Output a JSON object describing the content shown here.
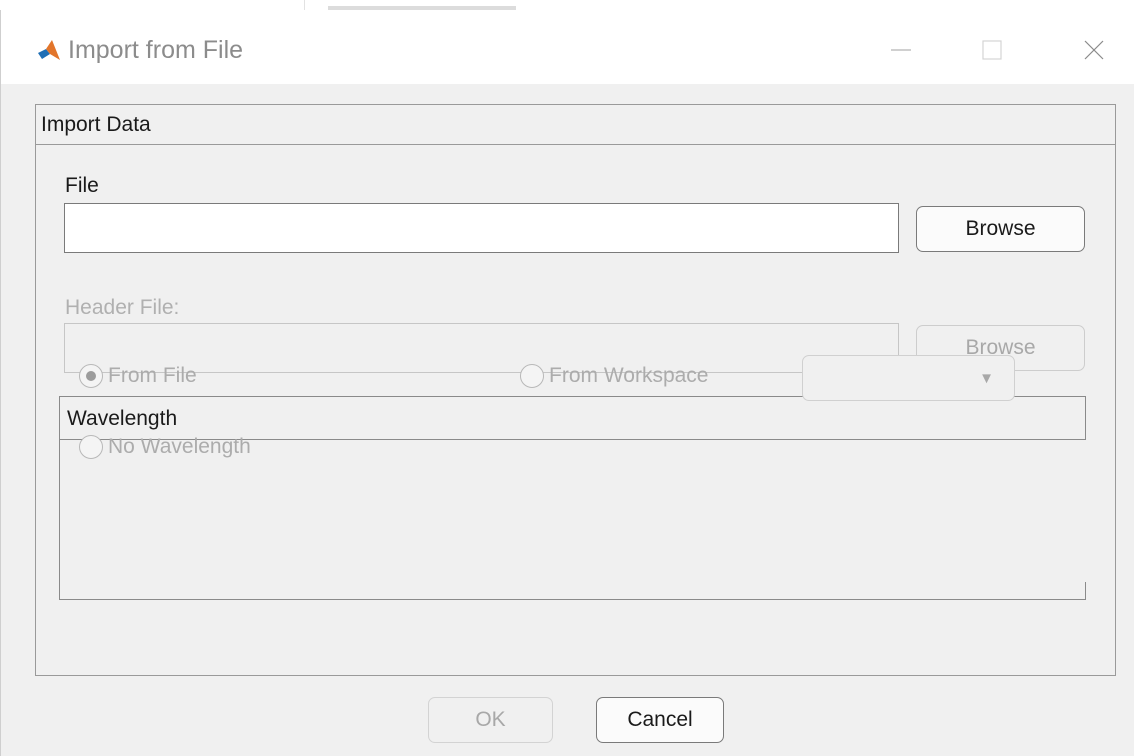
{
  "window": {
    "title": "Import from File",
    "app_icon": "matlab-icon",
    "controls": [
      "minimize-icon",
      "maximize-icon",
      "close-icon"
    ]
  },
  "panel": {
    "title": "Import Data",
    "file_label": "File",
    "file_value": "",
    "browse_label": "Browse",
    "header_label": "Header File:",
    "header_value": "",
    "header_browse_label": "Browse",
    "header_enabled": false
  },
  "wavelength": {
    "title": "Wavelength",
    "options": [
      {
        "label": "From File",
        "selected": true
      },
      {
        "label": "From Workspace",
        "selected": false
      },
      {
        "label": "No Wavelength",
        "selected": false
      }
    ],
    "workspace_select_value": "",
    "enabled": false
  },
  "footer": {
    "ok_label": "OK",
    "cancel_label": "Cancel",
    "ok_enabled": false
  },
  "colors": {
    "dialog_bg": "#f0f0f0",
    "border": "#9a9a9a",
    "disabled_text": "#acacac"
  }
}
